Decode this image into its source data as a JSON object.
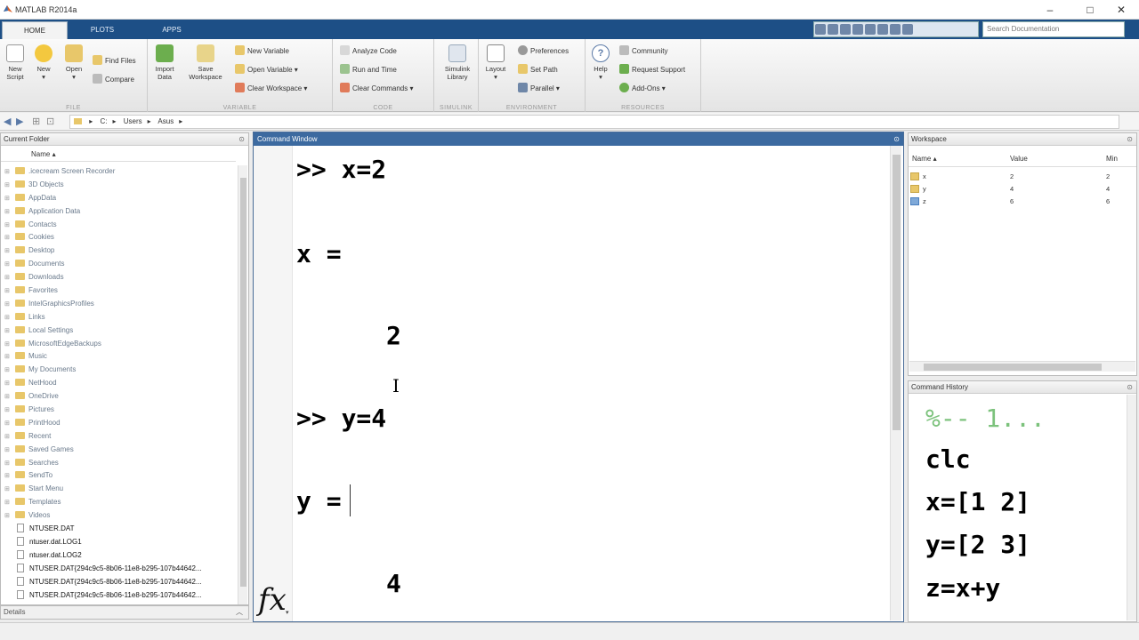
{
  "window": {
    "title": "MATLAB R2014a",
    "controls": {
      "minimize": "–",
      "maximize": "□",
      "close": "✕"
    }
  },
  "tabs": [
    "HOME",
    "PLOTS",
    "APPS"
  ],
  "search": {
    "placeholder": "Search Documentation"
  },
  "ribbon": {
    "file": {
      "label": "FILE",
      "new_script": "New\nScript",
      "new": "New",
      "open": "Open",
      "find_files": "Find Files",
      "compare": "Compare"
    },
    "variable": {
      "label": "VARIABLE",
      "import_data": "Import\nData",
      "save_workspace": "Save\nWorkspace",
      "new_variable": "New Variable",
      "open_variable": "Open Variable ▾",
      "clear_workspace": "Clear Workspace ▾"
    },
    "code": {
      "label": "CODE",
      "analyze_code": "Analyze Code",
      "run_and_time": "Run and Time",
      "clear_commands": "Clear Commands ▾"
    },
    "simulink": {
      "label": "SIMULINK",
      "simulink_library": "Simulink\nLibrary"
    },
    "environment": {
      "label": "ENVIRONMENT",
      "layout": "Layout",
      "preferences": "Preferences",
      "set_path": "Set Path",
      "parallel": "Parallel ▾"
    },
    "resources": {
      "label": "RESOURCES",
      "help": "Help",
      "community": "Community",
      "request_support": "Request Support",
      "add_ons": "Add-Ons ▾"
    }
  },
  "address": {
    "path": [
      "C:",
      "Users",
      "Asus"
    ]
  },
  "current_folder": {
    "title": "Current Folder",
    "column": "Name ▴",
    "folders": [
      ".icecream Screen Recorder",
      "3D Objects",
      "AppData",
      "Application Data",
      "Contacts",
      "Cookies",
      "Desktop",
      "Documents",
      "Downloads",
      "Favorites",
      "IntelGraphicsProfiles",
      "Links",
      "Local Settings",
      "MicrosoftEdgeBackups",
      "Music",
      "My Documents",
      "NetHood",
      "OneDrive",
      "Pictures",
      "PrintHood",
      "Recent",
      "Saved Games",
      "Searches",
      "SendTo",
      "Start Menu",
      "Templates",
      "Videos"
    ],
    "files": [
      "NTUSER.DAT",
      "ntuser.dat.LOG1",
      "ntuser.dat.LOG2",
      "NTUSER.DAT{294c9c5-8b06-11e8-b295-107b44642...",
      "NTUSER.DAT{294c9c5-8b06-11e8-b295-107b44642...",
      "NTUSER.DAT{294c9c5-8b06-11e8-b295-107b44642..."
    ],
    "details": "Details"
  },
  "command_window": {
    "title": "Command Window",
    "lines": [
      ">> x=2",
      "x =",
      "2",
      ">> y=4",
      "y =",
      "4"
    ],
    "fx": "fx"
  },
  "workspace": {
    "title": "Workspace",
    "columns": [
      "Name ▴",
      "Value",
      "Min"
    ],
    "rows": [
      {
        "name": "x",
        "value": "2",
        "min": "2"
      },
      {
        "name": "y",
        "value": "4",
        "min": "4"
      },
      {
        "name": "z",
        "value": "6",
        "min": "6"
      }
    ]
  },
  "command_history": {
    "title": "Command History",
    "lines": [
      "%-- 1...",
      "clc",
      "x=[1 2]",
      "y=[2 3]",
      "z=x+y"
    ]
  },
  "colors": {
    "tabstrip": "#1d4f86",
    "command_title": "#3c6aa0",
    "history_comment": "#7cc27c"
  }
}
